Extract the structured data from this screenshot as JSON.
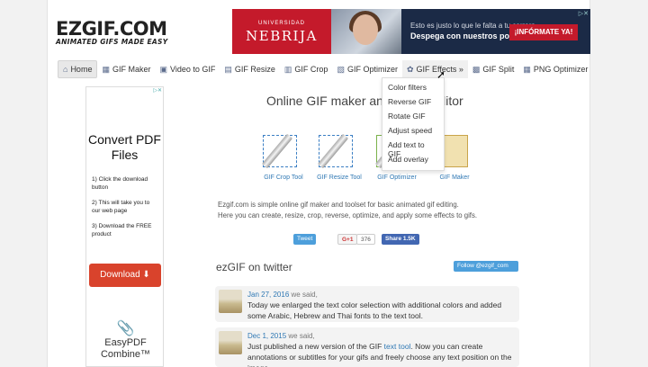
{
  "logo": {
    "main": "EZGIF.COM",
    "tagline": "ANIMATED GIFS MADE EASY"
  },
  "ad_banner": {
    "university_small": "UNIVERSIDAD",
    "university": "NEBRIJA",
    "line1": "Esto es justo lo que le falta a tu carrera",
    "line2": "Despega con nuestros postgrados",
    "cta": "¡INFÓRMATE YA!"
  },
  "nav": {
    "items": [
      {
        "label": "Home",
        "icon": "home-icon"
      },
      {
        "label": "GIF Maker",
        "icon": "gif-maker-icon"
      },
      {
        "label": "Video to GIF",
        "icon": "video-icon"
      },
      {
        "label": "GIF Resize",
        "icon": "resize-icon"
      },
      {
        "label": "GIF Crop",
        "icon": "crop-icon"
      },
      {
        "label": "GIF Optimizer",
        "icon": "optimizer-icon"
      },
      {
        "label": "GIF Effects »",
        "icon": "effects-icon"
      },
      {
        "label": "GIF Split",
        "icon": "split-icon"
      },
      {
        "label": "PNG Optimizer",
        "icon": "png-icon"
      }
    ],
    "effects_menu": [
      "Color filters",
      "Reverse GIF",
      "Rotate GIF",
      "Adjust speed",
      "Add text to GIF",
      "Add overlay"
    ]
  },
  "side_ad": {
    "heading": "Convert PDF Files",
    "steps": [
      "1) Click the download button",
      "2) This will take you to our web page",
      "3) Download the FREE product"
    ],
    "download": "Download ⬇",
    "brand": "EasyPDF Combine™"
  },
  "main": {
    "title": "Online GIF maker and image editor",
    "tools": [
      {
        "label": "GIF Crop Tool"
      },
      {
        "label": "GIF Resize Tool"
      },
      {
        "label": "GIF Optimizer"
      },
      {
        "label": "GIF Maker"
      }
    ],
    "description_1": "Ezgif.com is simple online gif maker and toolset for basic animated gif editing.",
    "description_2": "Here you can create, resize, crop, reverse, optimize, and apply some effects to gifs."
  },
  "share": {
    "tweet": "Tweet",
    "gplus": "G+1",
    "gplus_count": "376",
    "facebook": "Share 1.5K"
  },
  "twitter": {
    "heading": "ezGIF on twitter",
    "follow": "Follow @ezgif_com",
    "tweets": [
      {
        "date": "Jan 27, 2016",
        "said": "we said,",
        "text": "Today we enlarged the text color selection with additional colors and added some Arabic, Hebrew and Thai fonts to the text tool."
      },
      {
        "date": "Dec 1, 2015",
        "said": "we said,",
        "text_a": "Just published a new version of the GIF ",
        "link": "text tool",
        "text_b": ". Now you can create annotations or subtitles for your gifs and freely choose any text position on the image."
      }
    ]
  }
}
